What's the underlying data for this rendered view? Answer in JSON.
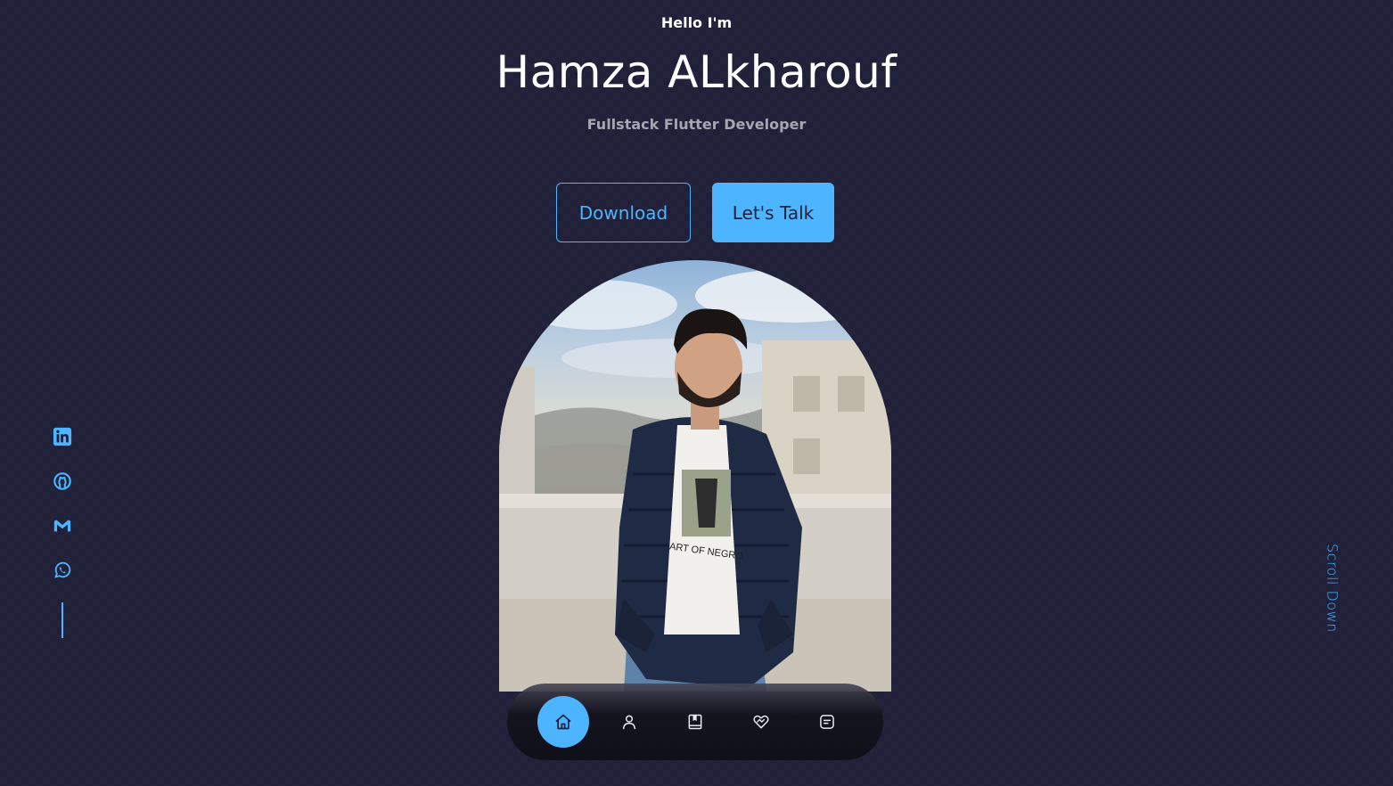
{
  "hero": {
    "greeting": "Hello I'm",
    "name": "Hamza ALkharouf",
    "role": "Fullstack Flutter Developer"
  },
  "buttons": {
    "download": "Download",
    "talk": "Let's Talk"
  },
  "socials": [
    {
      "icon": "linkedin-icon"
    },
    {
      "icon": "github-icon"
    },
    {
      "icon": "gmail-icon"
    },
    {
      "icon": "whatsapp-icon"
    }
  ],
  "scroll_label": "Scroll Down",
  "nav": {
    "items": [
      "home-icon",
      "user-icon",
      "book-icon",
      "services-icon",
      "message-icon"
    ],
    "active": "home-icon"
  },
  "photo": {
    "shirt_text": "ART OF NEGRO"
  },
  "colors": {
    "background": "#1f1f38",
    "accent": "#4db5ff",
    "text": "#ffffff"
  }
}
